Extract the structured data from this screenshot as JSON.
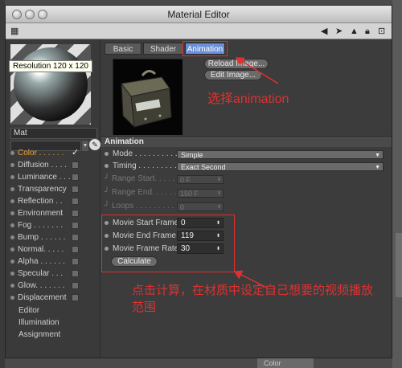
{
  "window": {
    "title": "Material Editor"
  },
  "preview": {
    "tooltip": "Resolution 120 x 120",
    "material_name": "Mat"
  },
  "channels": [
    {
      "label": "Color . . . . . .",
      "checked": true,
      "active": true
    },
    {
      "label": "Diffusion . . . .",
      "checked": false
    },
    {
      "label": "Luminance . . .",
      "checked": false
    },
    {
      "label": "Transparency",
      "checked": false
    },
    {
      "label": "Reflection . .",
      "checked": false
    },
    {
      "label": "Environment",
      "checked": false
    },
    {
      "label": "Fog . . . . . . .",
      "checked": false
    },
    {
      "label": "Bump . . . . . .",
      "checked": false
    },
    {
      "label": "Normal. . . . .",
      "checked": false
    },
    {
      "label": "Alpha . . . . . .",
      "checked": false
    },
    {
      "label": "Specular . . .",
      "checked": false
    },
    {
      "label": "Glow. . . . . . .",
      "checked": false
    },
    {
      "label": "Displacement",
      "checked": false
    }
  ],
  "extra_channels": [
    "Editor",
    "Illumination",
    "Assignment"
  ],
  "tabs": [
    "Basic",
    "Shader",
    "Animation"
  ],
  "buttons": {
    "reload": "Reload Image...",
    "edit": "Edit Image...",
    "calculate": "Calculate"
  },
  "annotations": {
    "select_animation": "选择animation",
    "calc_note": "点击计算，在材质中设定自己想要的视频播放范围"
  },
  "animation": {
    "header": "Animation",
    "mode": {
      "label": "Mode . . . . . . . . . . .",
      "value": "Simple"
    },
    "timing": {
      "label": "Timing . . . . . . . . . .",
      "value": "Exact Second"
    },
    "range_start": {
      "label": "Range Start. . . . . .",
      "value": "0 F"
    },
    "range_end": {
      "label": "Range End. . . . . . .",
      "value": "150 F"
    },
    "loops": {
      "label": "Loops . . . . . . . . . .",
      "value": "0"
    },
    "movie_start": {
      "label": "Movie Start Frame",
      "value": "0"
    },
    "movie_end": {
      "label": "Movie End Frame",
      "value": "119"
    },
    "movie_rate": {
      "label": "Movie Frame Rate",
      "value": "30"
    }
  },
  "background": {
    "partial_tab": "Color"
  },
  "colors": {
    "selected_tab": "#6a8fd6",
    "active_channel": "#f0a030",
    "annotation": "#e03030"
  },
  "icons": [
    "close-dot-icon",
    "minimize-dot-icon",
    "zoom-dot-icon",
    "grid-icon",
    "arrow-left-icon",
    "cursor-icon",
    "up-arrow-icon",
    "lock-icon",
    "expand-icon",
    "eyedropper-icon"
  ]
}
